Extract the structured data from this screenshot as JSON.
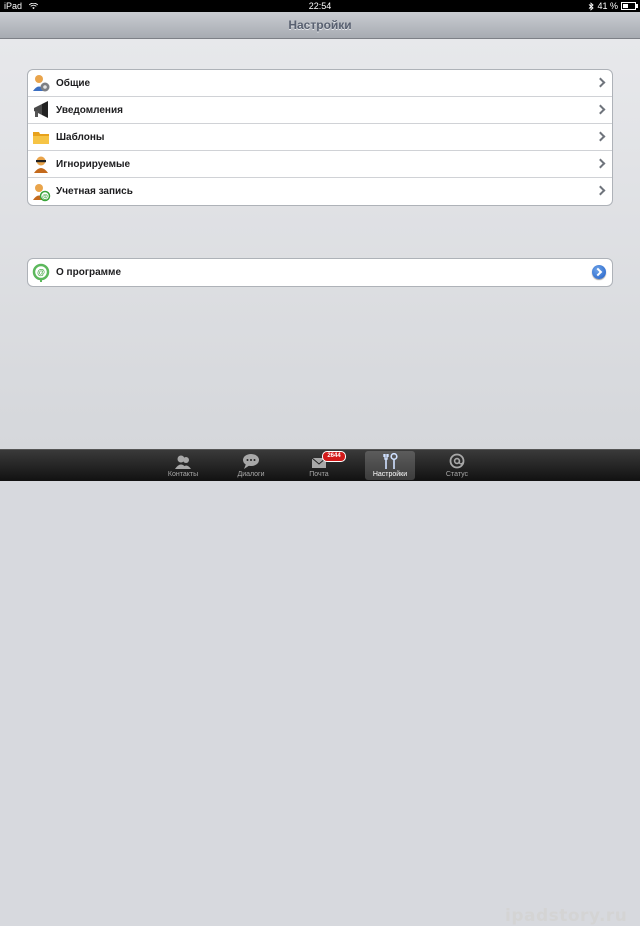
{
  "status_bar": {
    "device": "iPad",
    "time": "22:54",
    "battery_percent": "41 %",
    "battery_level": 0.41
  },
  "nav": {
    "title": "Настройки"
  },
  "settings_group": {
    "items": [
      {
        "label": "Общие",
        "icon": "general-gear-icon"
      },
      {
        "label": "Уведомления",
        "icon": "megaphone-icon"
      },
      {
        "label": "Шаблоны",
        "icon": "folder-icon"
      },
      {
        "label": "Игнорируемые",
        "icon": "ignored-user-icon"
      },
      {
        "label": "Учетная запись",
        "icon": "account-icon"
      }
    ]
  },
  "about_group": {
    "items": [
      {
        "label": "О программе",
        "icon": "icq-logo-icon"
      }
    ]
  },
  "tab_bar": {
    "tabs": [
      {
        "label": "Контакты",
        "icon": "contacts-icon"
      },
      {
        "label": "Диалоги",
        "icon": "chat-bubble-icon"
      },
      {
        "label": "Почта",
        "icon": "mail-icon",
        "badge": "2644"
      },
      {
        "label": "Настройки",
        "icon": "settings-tools-icon",
        "active": true
      },
      {
        "label": "Статус",
        "icon": "at-sign-icon"
      }
    ]
  },
  "watermark": "ipadstory.ru",
  "colors": {
    "nav_title": "#586070",
    "badge": "#d21a1a",
    "disclosure": "#1f5ec7"
  }
}
